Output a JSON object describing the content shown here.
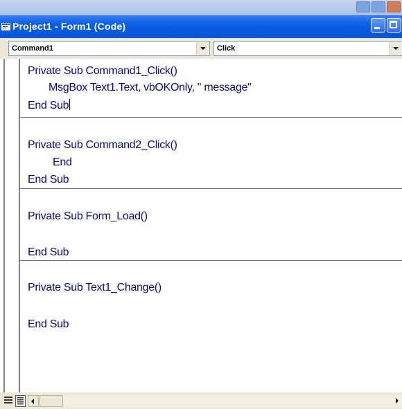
{
  "window": {
    "title": "Project1 - Form1 (Code)"
  },
  "object_combo": {
    "value": "Command1"
  },
  "procedure_combo": {
    "value": "Click"
  },
  "code": {
    "procedures": [
      {
        "lines": [
          "Private Sub Command1_Click()",
          "MsgBox Text1.Text, vbOKOnly, \" message\"",
          "End Sub"
        ]
      },
      {
        "lines": [
          "Private Sub Command2_Click()",
          "End",
          "End Sub"
        ]
      },
      {
        "lines": [
          "Private Sub Form_Load()",
          "",
          "End Sub"
        ]
      },
      {
        "lines": [
          "Private Sub Text1_Change()",
          "",
          "End Sub"
        ]
      }
    ]
  },
  "icons": {
    "app": "code-window-icon",
    "minimize": "minimize-icon",
    "maximize": "maximize-icon",
    "procedure_view": "procedure-view-icon",
    "full_module_view": "full-module-view-icon"
  },
  "colors": {
    "title_bar": "#0b5ee5",
    "code_text": "#0a0a80",
    "separator": "#707070"
  }
}
